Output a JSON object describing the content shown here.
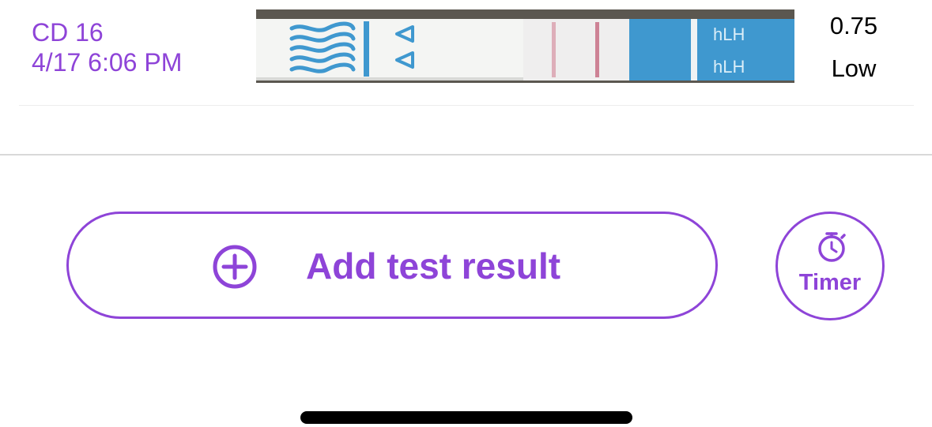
{
  "test_result": {
    "cycle_day": "CD 16",
    "datetime": "4/17 6:06 PM",
    "value": "0.75",
    "level": "Low",
    "strip_photo": {
      "label_top": "hLH",
      "label_bottom": "hLH",
      "strip_color": "#f4f5f3",
      "blue_color": "#3f98cf",
      "line_color": "#d07a8e"
    }
  },
  "actions": {
    "add_test_label": "Add test result",
    "timer_label": "Timer"
  },
  "colors": {
    "accent": "#8e44d8",
    "text": "#000000",
    "divider": "#d9d9d9"
  },
  "icons": {
    "add": "plus-circle-icon",
    "timer": "stopwatch-icon"
  }
}
